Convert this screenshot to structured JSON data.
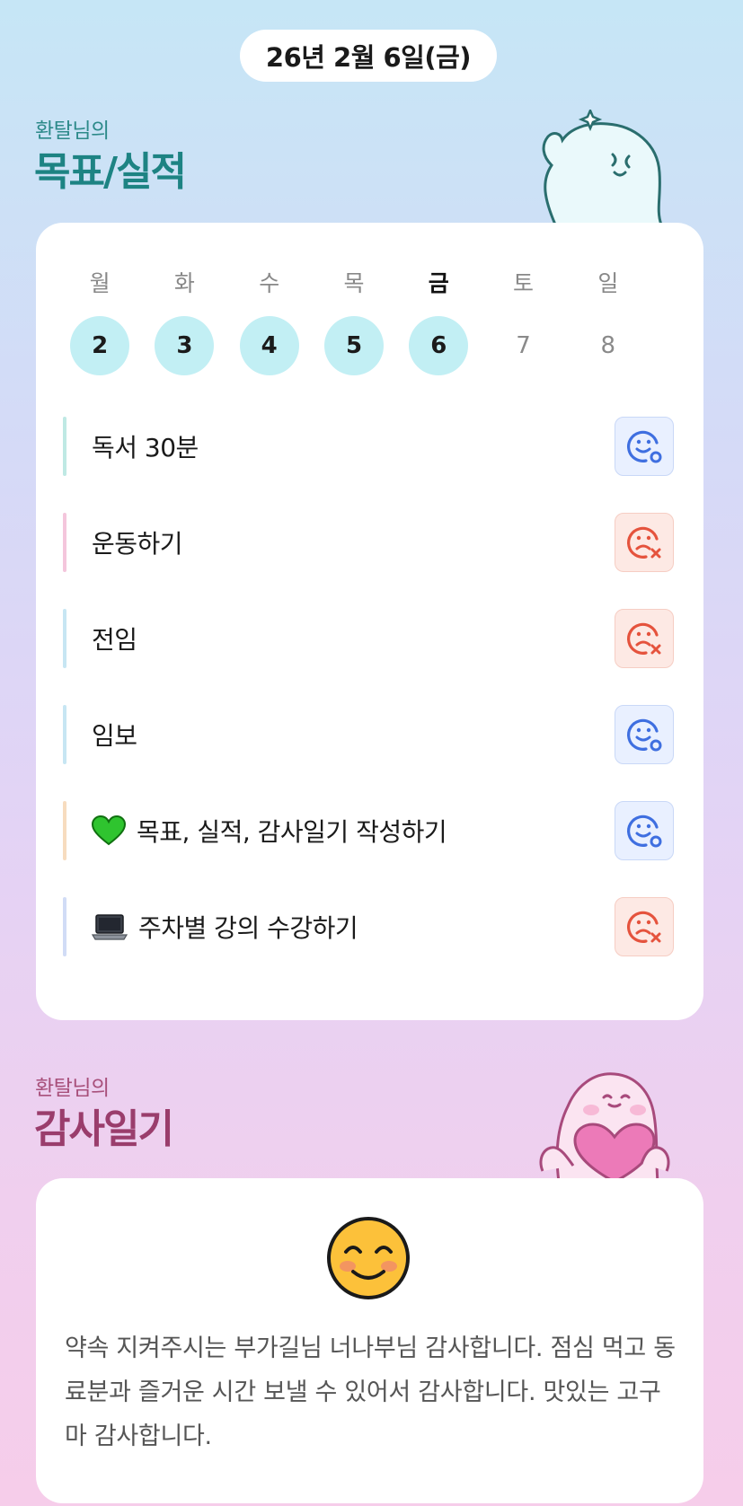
{
  "date_label": "26년 2월 6일(금)",
  "goals_section": {
    "subtitle": "환탈님의",
    "title": "목표/실적"
  },
  "week": {
    "days": [
      {
        "name": "월",
        "num": "2",
        "filled": true,
        "today": false
      },
      {
        "name": "화",
        "num": "3",
        "filled": true,
        "today": false
      },
      {
        "name": "수",
        "num": "4",
        "filled": true,
        "today": false
      },
      {
        "name": "목",
        "num": "5",
        "filled": true,
        "today": false
      },
      {
        "name": "금",
        "num": "6",
        "filled": true,
        "today": true
      },
      {
        "name": "토",
        "num": "7",
        "filled": false,
        "today": false
      },
      {
        "name": "일",
        "num": "8",
        "filled": false,
        "today": false
      }
    ]
  },
  "goals": [
    {
      "label": "독서 30분",
      "emoji": "",
      "bar_color": "#bfe9e4",
      "status": "achieved"
    },
    {
      "label": "운동하기",
      "emoji": "",
      "bar_color": "#f4c6dc",
      "status": "missed"
    },
    {
      "label": "전임",
      "emoji": "",
      "bar_color": "#c7e6f3",
      "status": "missed"
    },
    {
      "label": "임보",
      "emoji": "",
      "bar_color": "#c7e6f3",
      "status": "achieved"
    },
    {
      "label": "목표, 실적, 감사일기 작성하기",
      "emoji": "green-heart",
      "bar_color": "#f7dcbf",
      "status": "achieved"
    },
    {
      "label": "주차별 강의 수강하기",
      "emoji": "laptop",
      "bar_color": "#d1dcf6",
      "status": "missed"
    }
  ],
  "diary_section": {
    "subtitle": "환탈님의",
    "title": "감사일기"
  },
  "diary": {
    "mood_icon": "smiling-face-icon",
    "text": "약속 지켜주시는 부가길님 너나부님 감사합니다. 점심 먹고 동료분과 즐거운 시간 보낼 수 있어서 감사합니다. 맛있는 고구마 감사합니다."
  },
  "colors": {
    "teal_title": "#1d8383",
    "pink_title": "#9a3d6c",
    "day_circle": "#c2eff4",
    "achieved_icon": "#3f6fe0",
    "missed_icon": "#e5533d"
  }
}
